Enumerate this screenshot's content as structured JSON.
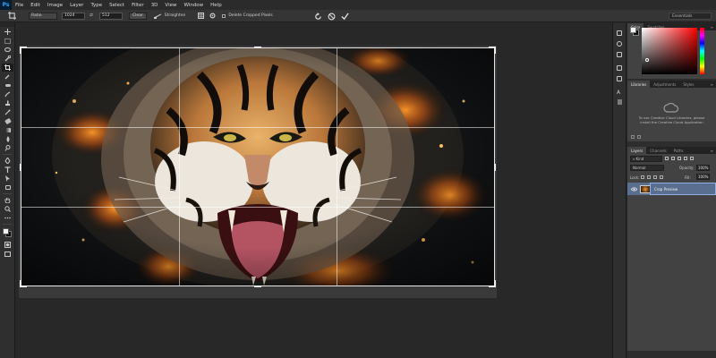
{
  "app": {
    "logo": "Ps"
  },
  "menubar": {
    "items": [
      "File",
      "Edit",
      "Image",
      "Layer",
      "Type",
      "Select",
      "Filter",
      "3D",
      "View",
      "Window",
      "Help"
    ]
  },
  "options": {
    "ratio_select": "Ratio",
    "width_value": "1024",
    "swap_symbol": "⇄",
    "height_value": "512",
    "clear_label": "Clear",
    "straighten_label": "Straighten",
    "delete_cropped_label": "Delete Cropped Pixels",
    "delete_cropped_checked": false,
    "workspace": "Essentials"
  },
  "color_panel": {
    "tabs": [
      "Color",
      "Swatches"
    ],
    "foreground": "#f2f2f2",
    "background": "#0a0a0a",
    "hue_accent": "#ff0000"
  },
  "libraries_panel": {
    "tabs": [
      "Libraries",
      "Adjustments",
      "Styles"
    ],
    "message": "To use Creative Cloud Libraries, please install the Creative Cloud Application"
  },
  "layers_panel": {
    "tabs": [
      "Layers",
      "Channels",
      "Paths"
    ],
    "kind_filter": "Kind",
    "blend_mode": "Normal",
    "opacity_label": "Opacity:",
    "opacity_value": "100%",
    "lock_label": "Lock:",
    "fill_label": "Fill:",
    "fill_value": "100%",
    "layers": [
      {
        "name": "Crop Preview",
        "visible": true,
        "selected": true
      }
    ]
  },
  "theme": {
    "selection_blue": "#5a6f8f",
    "panel_bg": "#424242",
    "app_bg": "#282828"
  }
}
